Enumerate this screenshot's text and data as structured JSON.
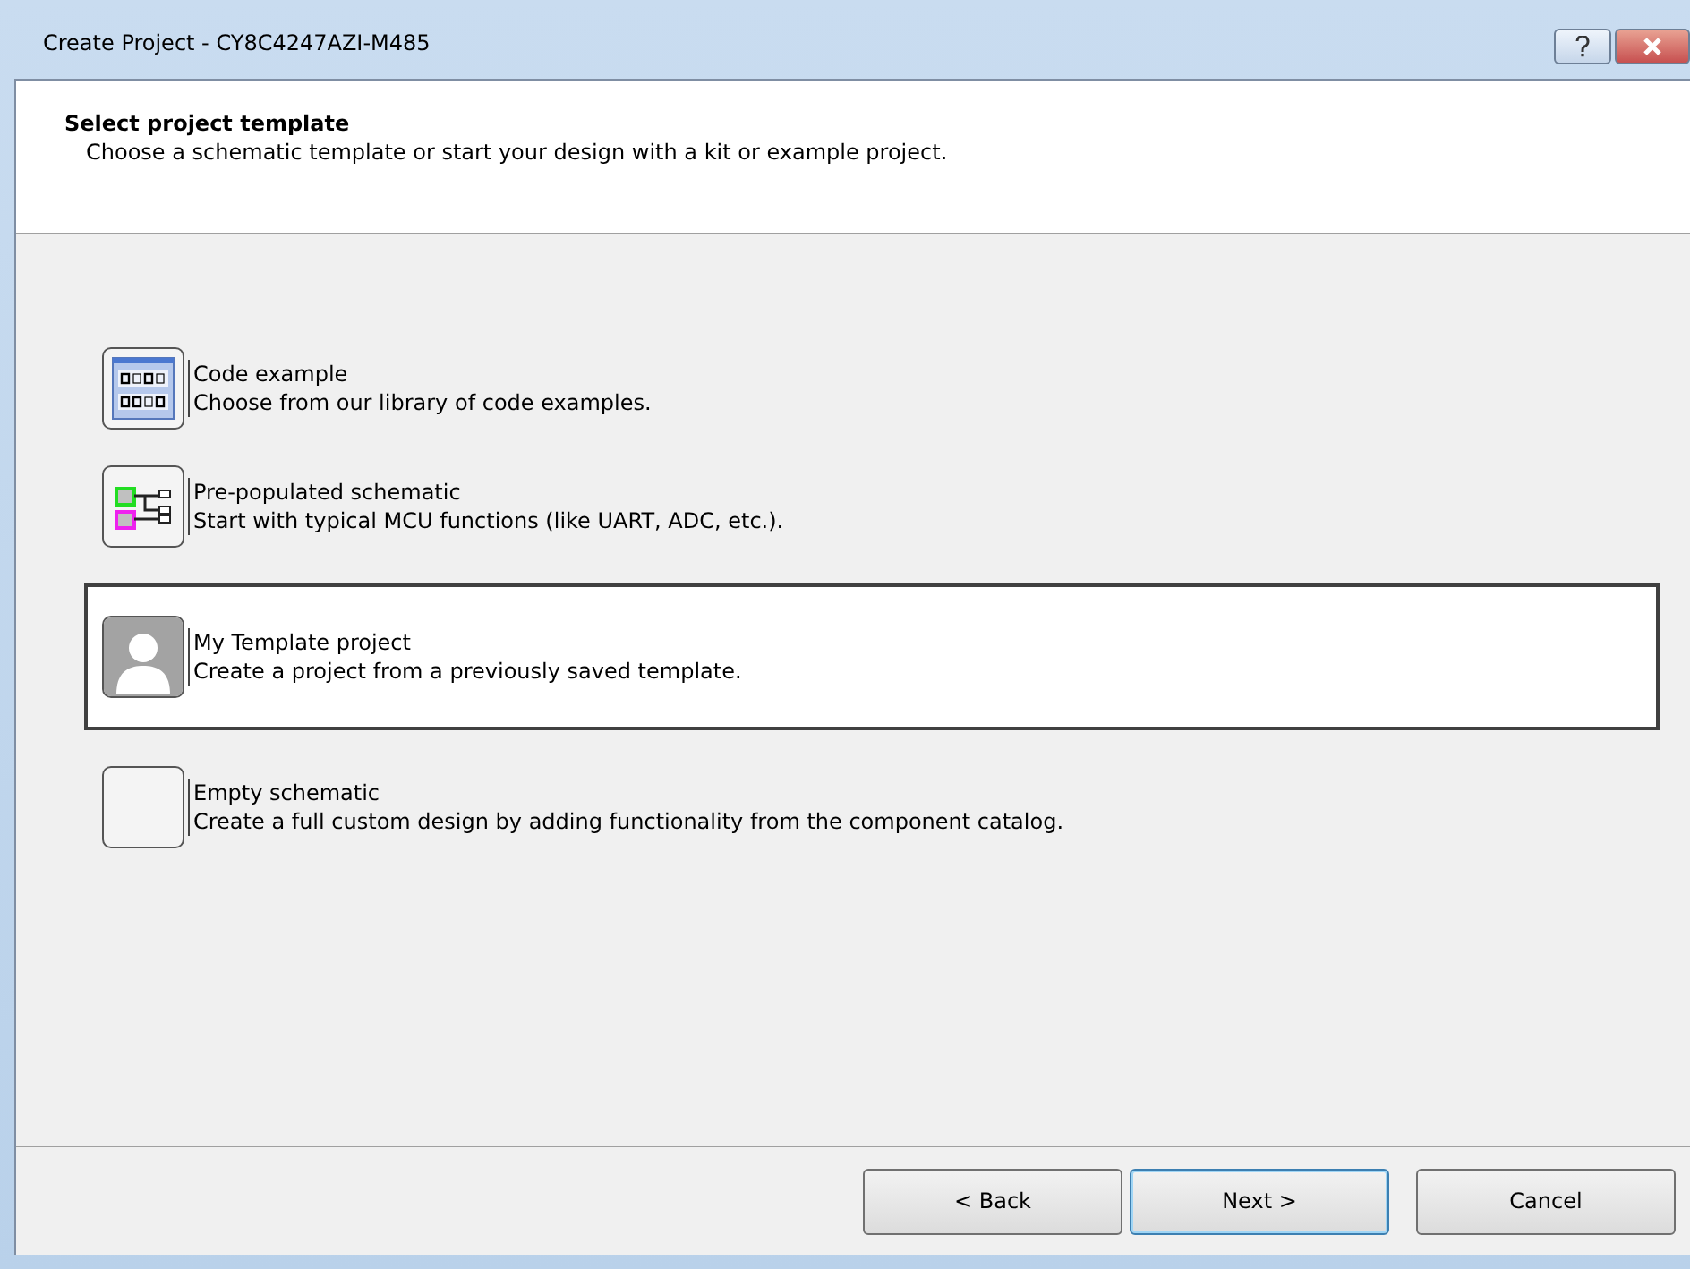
{
  "window": {
    "title": "Create Project - CY8C4247AZI-M485"
  },
  "header": {
    "title": "Select project template",
    "subtitle": "Choose a schematic template or start your design with a kit or example project."
  },
  "options": [
    {
      "kind": "code",
      "title": "Code example",
      "description": "Choose from our library of code examples.",
      "selected": false
    },
    {
      "kind": "schematic",
      "title": "Pre-populated schematic",
      "description": "Start with typical MCU functions (like UART, ADC, etc.).",
      "selected": false
    },
    {
      "kind": "person",
      "title": "My Template project",
      "description": "Create a project from a previously saved template.",
      "selected": true
    },
    {
      "kind": "empty",
      "title": "Empty schematic",
      "description": "Create a full custom design by adding functionality from the component catalog.",
      "selected": false
    }
  ],
  "buttons": [
    {
      "label": "< Back",
      "focused": false
    },
    {
      "label": "Next >",
      "focused": true
    },
    {
      "label": "Cancel",
      "focused": false
    }
  ]
}
